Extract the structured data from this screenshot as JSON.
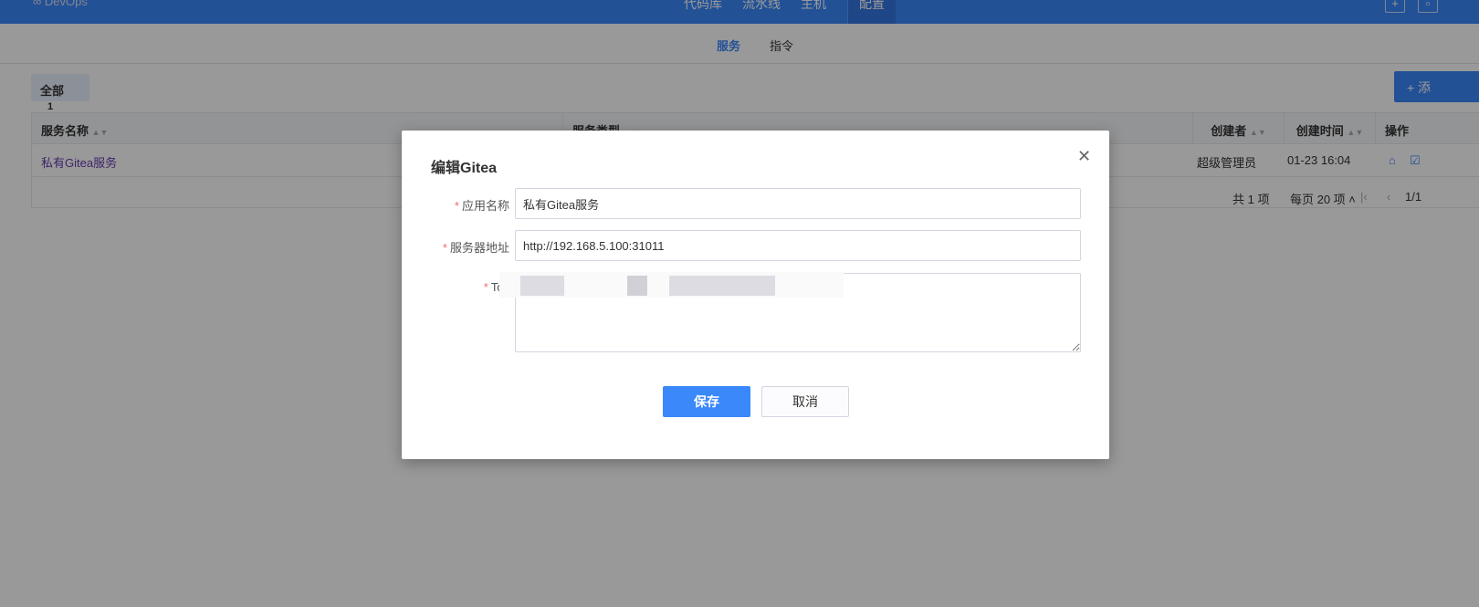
{
  "topbar": {
    "logo": "∞ DevOps",
    "nav": [
      "代码库",
      "流水线",
      "主机",
      "配置"
    ],
    "active": "配置"
  },
  "subnav": {
    "tabs": [
      "服务",
      "指令"
    ],
    "active": "服务"
  },
  "filter": {
    "label": "全部",
    "count": "1"
  },
  "add_button": "+ 添",
  "table": {
    "columns": [
      "服务名称",
      "服务类型",
      "创建者",
      "创建时间",
      "操作"
    ],
    "rows": [
      {
        "name": "私有Gitea服务",
        "type": "",
        "creator": "超级管理员",
        "created": "01-23 16:04"
      }
    ]
  },
  "pager": {
    "total": "共 1 项",
    "per_page": "每页 20 项",
    "page": "1/1"
  },
  "modal": {
    "title": "编辑Gitea",
    "fields": [
      {
        "label": "应用名称",
        "value": "私有Gitea服务"
      },
      {
        "label": "服务器地址",
        "value": "http://192.168.5.100:31011"
      },
      {
        "label": "Tok",
        "value": ""
      }
    ],
    "save": "保存",
    "cancel": "取消"
  },
  "colors": {
    "accent": "#3a88fa",
    "required": "#f56c6c"
  }
}
